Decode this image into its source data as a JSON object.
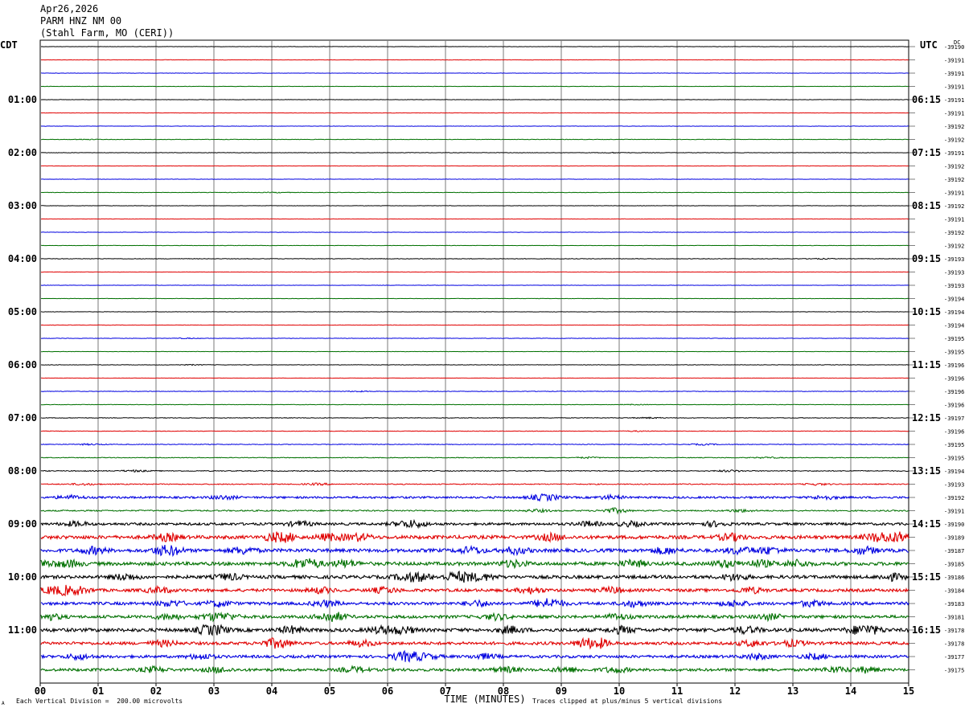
{
  "header": {
    "date": "Apr26,2026",
    "channel": "PARM HNZ NM 00",
    "station": "(Stahl Farm, MO (CERI))"
  },
  "footer": {
    "left_note": "Each Vertical Division =  200.00 microvolts",
    "right_note": "Traces clipped at plus/minus 5 vertical divisions",
    "corner_mark": "A"
  },
  "chart_data": {
    "type": "line",
    "title": "",
    "xlabel": "TIME (MINUTES)",
    "ylabel_left": "CDT",
    "ylabel_right": "UTC",
    "dc_label": "DC",
    "x_ticks": [
      "00",
      "01",
      "02",
      "03",
      "04",
      "05",
      "06",
      "07",
      "08",
      "09",
      "10",
      "11",
      "12",
      "13",
      "14",
      "15"
    ],
    "xlim": [
      0,
      15
    ],
    "grid": true,
    "trace_colors": [
      "#000000",
      "#e00000",
      "#0000e0",
      "#007000"
    ],
    "left_time_labels": [
      "01:00",
      "02:00",
      "03:00",
      "04:00",
      "05:00",
      "06:00",
      "07:00",
      "08:00",
      "09:00",
      "10:00",
      "11:00"
    ],
    "right_time_labels": [
      "06:15",
      "07:15",
      "08:15",
      "09:15",
      "10:15",
      "11:15",
      "12:15",
      "13:15",
      "14:15",
      "15:15",
      "16:15"
    ],
    "first_hour_label_row": 4,
    "dc_offsets": [
      -39190,
      -39191,
      -39191,
      -39191,
      -39191,
      -39191,
      -39192,
      -39192,
      -39191,
      -39192,
      -39192,
      -39191,
      -39192,
      -39191,
      -39192,
      -39192,
      -39193,
      -39193,
      -39193,
      -39194,
      -39194,
      -39194,
      -39195,
      -39195,
      -39196,
      -39196,
      -39196,
      -39196,
      -39197,
      -39196,
      -39195,
      -39195,
      -39194,
      -39193,
      -39192,
      -39191,
      -39190,
      -39189,
      -39187,
      -39185,
      -39186,
      -39184,
      -39183,
      -39181,
      -39178,
      -39178,
      -39177,
      -39175
    ],
    "trace_activity": [
      0.3,
      0.3,
      0.3,
      0.3,
      0.3,
      0.3,
      0.3,
      0.4,
      0.4,
      0.3,
      0.3,
      0.4,
      0.3,
      0.3,
      0.3,
      0.3,
      0.5,
      0.3,
      0.3,
      0.3,
      0.3,
      0.3,
      0.4,
      0.3,
      0.4,
      0.3,
      0.5,
      0.4,
      0.6,
      0.5,
      0.7,
      0.7,
      0.9,
      1.0,
      2.0,
      1.4,
      2.5,
      3.5,
      3.5,
      3.5,
      3.3,
      3.0,
      3.0,
      3.0,
      3.5,
      3.0,
      2.8,
      2.8
    ]
  }
}
